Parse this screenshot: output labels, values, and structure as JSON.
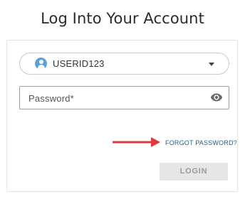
{
  "header": {
    "title": "Log Into Your Account"
  },
  "user_select": {
    "value": "USERID123",
    "avatar_icon": "user-icon",
    "caret_icon": "caret-down-icon"
  },
  "password": {
    "value": "",
    "placeholder": "Password*",
    "visibility_icon": "eye-icon"
  },
  "links": {
    "forgot_password": "FORGOT PASSWORD?"
  },
  "actions": {
    "login_label": "LOGIN"
  },
  "colors": {
    "avatar": "#5aa2d6",
    "link": "#1f5f8b",
    "annotation_arrow": "#e0393e",
    "button_bg": "#e6e6e6",
    "button_text": "#9a9a9a"
  }
}
